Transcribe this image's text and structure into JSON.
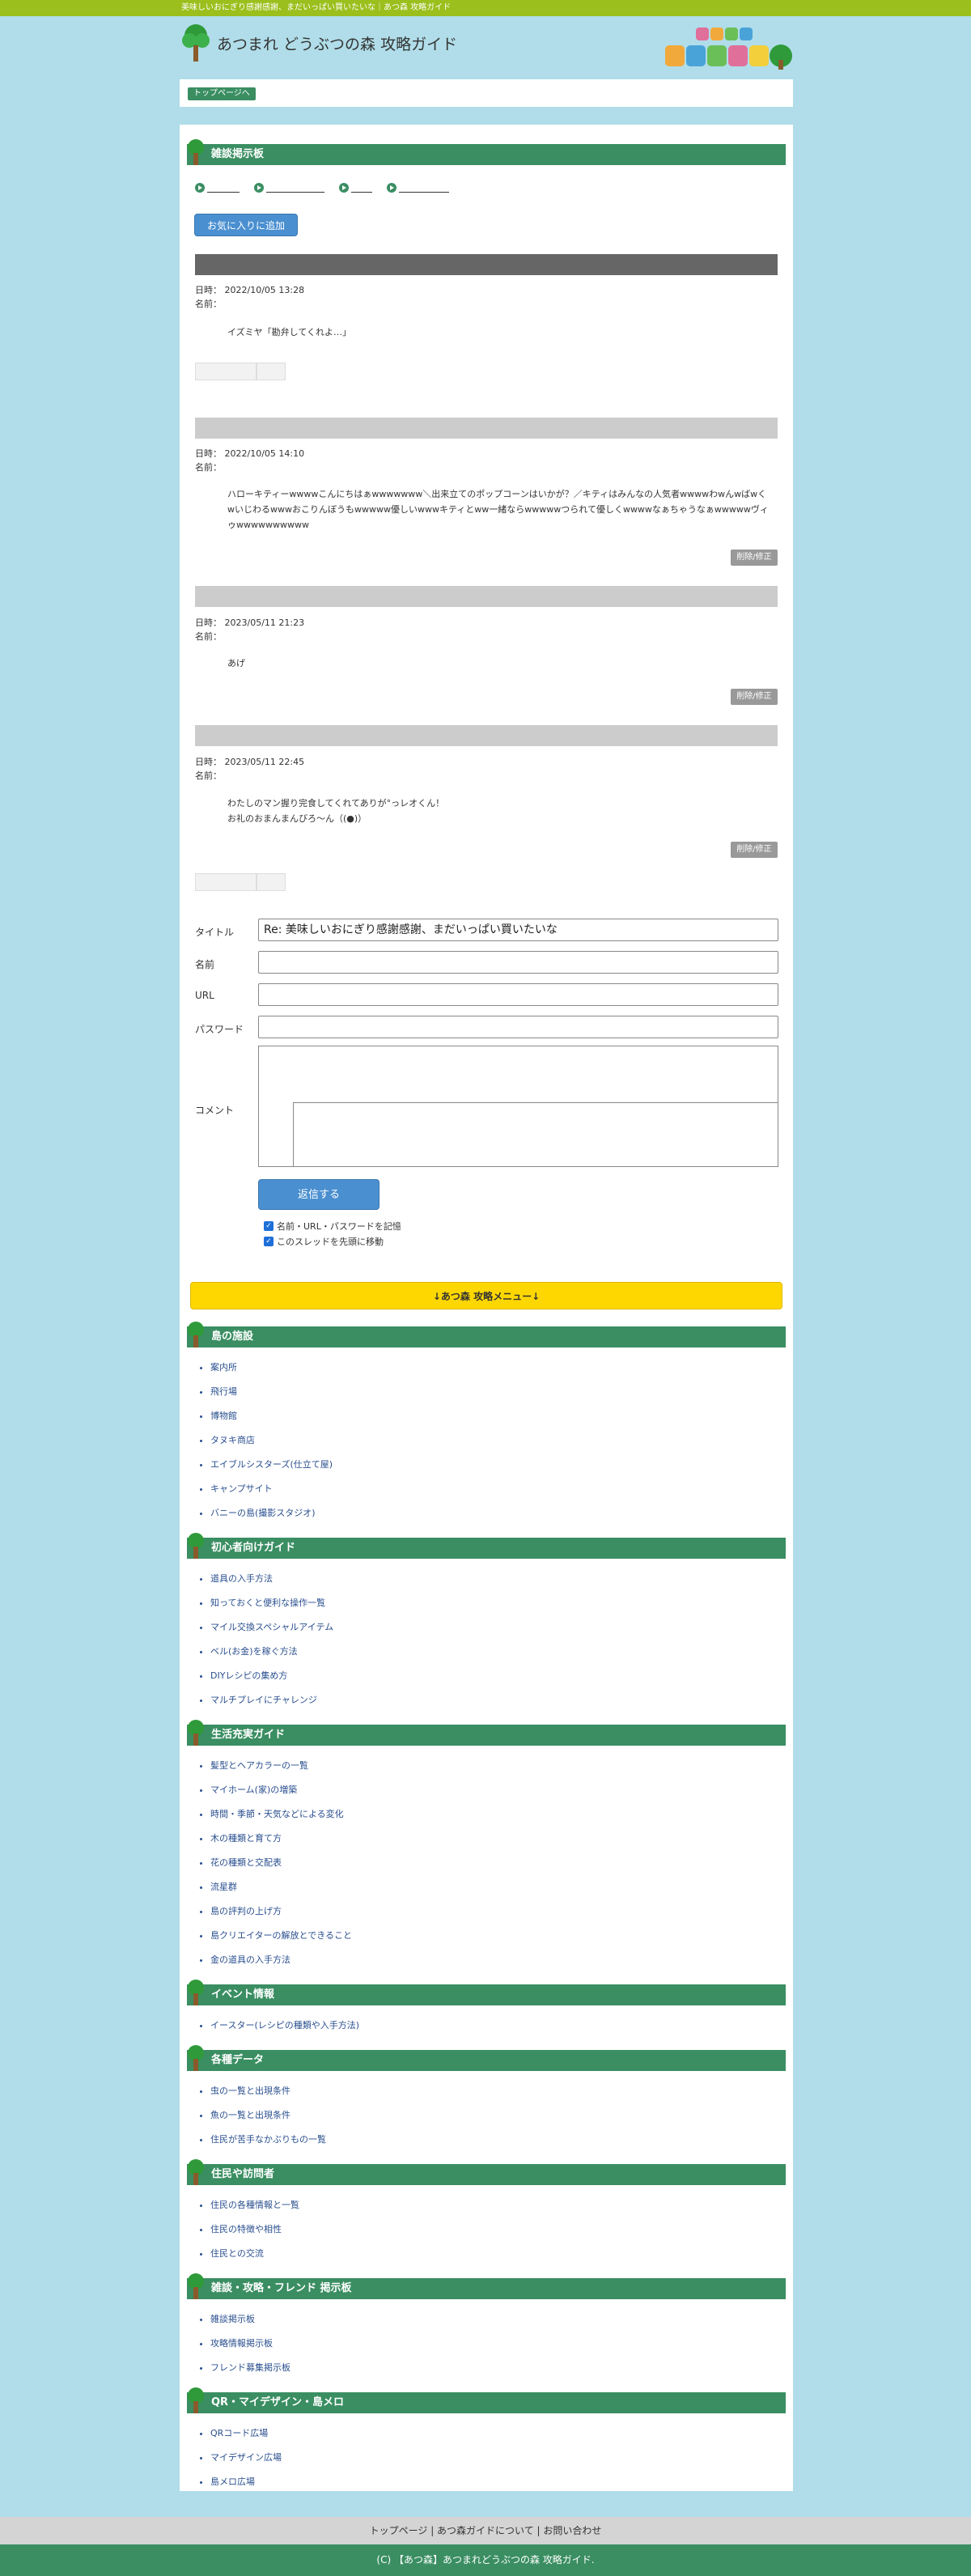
{
  "topbar": {
    "text": "美味しいおにぎり感謝感謝、まだいっぱい買いたいな｜あつ森 攻略ガイド"
  },
  "header": {
    "site_title": "あつまれ どうぶつの森 攻略ガイド",
    "logo_text": "あつまれ どうぶつの森"
  },
  "breadcrumb": {
    "top_link": "トップページへ"
  },
  "board": {
    "title": "雑談掲示板",
    "favorite_button": "お気に入りに追加",
    "posts": [
      {
        "date": "日時： 2022/10/05 13:28",
        "name": "名前：",
        "lines": [
          "イズミヤ「勘弁してくれよ…」"
        ],
        "has_delete": false
      },
      {
        "date": "日時： 2022/10/05 14:10",
        "name": "名前：",
        "lines": [
          "ハローキティーwwwwこんにちはぁwwwwwww＼出来立てのポップコーンはいかが？／キティはみんなの人気者wwwwわwんwばwくwいじわるwwwおこりんぼうもwwwww優しいwwwキティとww一緒ならwwwwwつられて優しくwwwwなぁちゃうなぁwwwwwヴィゥwwwwwwwwww"
        ],
        "has_delete": true
      },
      {
        "date": "日時： 2023/05/11 21:23",
        "name": "名前：",
        "lines": [
          "あげ"
        ],
        "has_delete": true
      },
      {
        "date": "日時： 2023/05/11 22:45",
        "name": "名前：",
        "lines": [
          "わたしのマン握り完食してくれてありが°っレオくん！",
          "お礼のおまんまんびろ〜ん（(●)）"
        ],
        "has_delete": true
      }
    ],
    "delete_label": "削除/修正"
  },
  "form": {
    "title_label": "タイトル",
    "title_value": "Re: 美味しいおにぎり感謝感謝、まだいっぱい買いたいな",
    "name_label": "名前",
    "url_label": "URL",
    "password_label": "パスワード",
    "comment_label": "コメント",
    "submit": "返信する",
    "remember": "名前・URL・パスワードを記憶",
    "move_top": "このスレッドを先頭に移動"
  },
  "menu_bar": "↓あつ森 攻略メニュー↓",
  "menus": [
    {
      "title": "島の施設",
      "items": [
        "案内所",
        "飛行場",
        "博物館",
        "タヌキ商店",
        "エイブルシスターズ(仕立て屋)",
        "キャンプサイト",
        "バニーの島(撮影スタジオ)"
      ]
    },
    {
      "title": "初心者向けガイド",
      "items": [
        "道具の入手方法",
        "知っておくと便利な操作一覧",
        "マイル交換スペシャルアイテム",
        "ベル(お金)を稼ぐ方法",
        "DIYレシピの集め方",
        "マルチプレイにチャレンジ"
      ]
    },
    {
      "title": "生活充実ガイド",
      "items": [
        "髪型とヘアカラーの一覧",
        "マイホーム(家)の増築",
        "時間・季節・天気などによる変化",
        "木の種類と育て方",
        "花の種類と交配表",
        "流星群",
        "島の評判の上げ方",
        "島クリエイターの解放とできること",
        "金の道具の入手方法"
      ]
    },
    {
      "title": "イベント情報",
      "items": [
        "イースター(レシピの種類や入手方法)"
      ]
    },
    {
      "title": "各種データ",
      "items": [
        "虫の一覧と出現条件",
        "魚の一覧と出現条件",
        "住民が苦手なかぶりもの一覧"
      ]
    },
    {
      "title": "住民や訪問者",
      "items": [
        "住民の各種情報と一覧",
        "住民の特徴や相性",
        "住民との交流"
      ]
    },
    {
      "title": "雑談・攻略・フレンド 掲示板",
      "items": [
        "雑談掲示板",
        "攻略情報掲示板",
        "フレンド募集掲示板"
      ]
    },
    {
      "title": "QR・マイデザイン・島メロ",
      "items": [
        "QRコード広場",
        "マイデザイン広場",
        "島メロ広場"
      ]
    }
  ],
  "footer": {
    "links": "トップページ | あつ森ガイドについて | お問い合わせ",
    "copyright": "(C) 【あつ森】あつまれどうぶつの森 攻略ガイド."
  },
  "colors": {
    "green": "#3a8e62",
    "lime": "#9bbf1c",
    "sky": "#b0dde9",
    "yellow": "#ffd700",
    "blue": "#4a8fd0"
  }
}
